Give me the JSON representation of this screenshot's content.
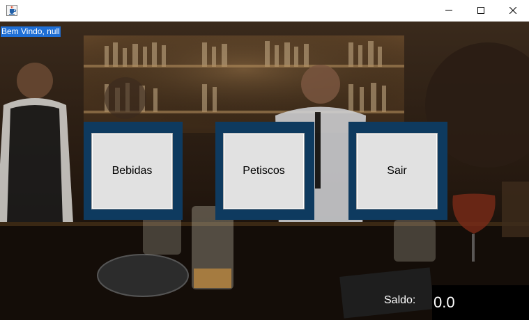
{
  "window": {
    "icon": "java-coffee-icon",
    "controls": [
      "minimize-icon",
      "maximize-icon",
      "close-icon"
    ]
  },
  "welcome": {
    "text": "Bem Vindo, null"
  },
  "menu": {
    "buttons": [
      {
        "label": "Bebidas"
      },
      {
        "label": "Petiscos"
      },
      {
        "label": "Sair"
      }
    ],
    "tile_color": "#0e3a5f"
  },
  "balance": {
    "label": "Saldo:",
    "value": "0.0"
  }
}
